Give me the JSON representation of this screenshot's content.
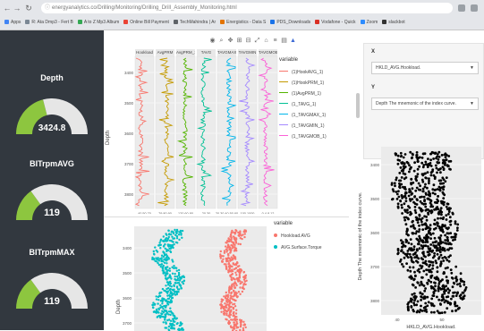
{
  "browser": {
    "url": "energyanalytics.co/Drilling/Monitoring/Drilling_Drill_Assembly_Monitoring.html",
    "bookmarks": [
      "Apps",
      "R: Ata Dmp3 - Fert B",
      "A to Z Mp3 Album",
      "Online Bill Payment",
      "TechMahindra | Ar",
      "Energistics - Data S",
      "PDS_Downloads",
      "Vodafone - Quick",
      "Zoom",
      "slackbot"
    ]
  },
  "gauges": [
    {
      "label": "Depth",
      "value": "3424.8",
      "fill": 0.42
    },
    {
      "label": "BITrpmAVG",
      "value": "119",
      "fill": 0.3
    },
    {
      "label": "BITrpmMAX",
      "value": "119",
      "fill": 0.3
    }
  ],
  "track_plot": {
    "legend_title": "variable",
    "y_label": "Depth",
    "y_ticks": [
      "3400",
      "3500",
      "3600",
      "3700",
      "3800"
    ],
    "tracks": [
      {
        "header": "Hookload",
        "x_ticks": "40 50 70",
        "color": "#f8766d"
      },
      {
        "header": "AvgPRM",
        "x_ticks": "79 80 90",
        "color": "#c49a00"
      },
      {
        "header": "AvgPRM_1",
        "x_ticks": "120 60 80",
        "color": "#53b400"
      },
      {
        "header": "TAVG",
        "x_ticks": "20 30",
        "color": "#00c094"
      },
      {
        "header": "TAVGMAX",
        "x_ticks": "20 30 40 50 60",
        "color": "#00b6eb"
      },
      {
        "header": "TAVGMIN",
        "x_ticks": "100 1000",
        "color": "#a58aff"
      },
      {
        "header": "TAVGMOB",
        "x_ticks": "0 4 8 12",
        "color": "#fb61d7"
      }
    ],
    "legend": [
      {
        "label": "(1)HookAVG_1)",
        "color": "#f8766d"
      },
      {
        "label": "(1)HookPRM_1)",
        "color": "#c49a00"
      },
      {
        "label": "(1)AvgPRM_1)",
        "color": "#53b400"
      },
      {
        "label": "(1_TAVG_1)",
        "color": "#00c094"
      },
      {
        "label": "(1_TAVGMAX_1)",
        "color": "#00b6eb"
      },
      {
        "label": "(1_TAVGMIN_1)",
        "color": "#a58aff"
      },
      {
        "label": "(1_TAVGMOB_1)",
        "color": "#fb61d7"
      }
    ]
  },
  "scatter_left": {
    "legend_title": "variable",
    "y_label": "Depth",
    "y_ticks": [
      "3400",
      "3500",
      "3600",
      "3700"
    ],
    "legend": [
      {
        "label": "Hookload.AVG",
        "color": "#f8766d"
      },
      {
        "label": "AVG.Surface.Torque",
        "color": "#00bfc4"
      }
    ]
  },
  "controls": {
    "x_label": "X",
    "x_value": "HKLD_AVG.Hookload.",
    "y_label": "Y",
    "y_value": "Depth The mnemonic of the index curve."
  },
  "scatter_right": {
    "x_label": "HKLD_AVG.Hookload.",
    "y_label": "Depth The mnemonic of the index curve.",
    "x_ticks": [
      "40",
      "50"
    ],
    "y_ticks": [
      "3400",
      "3500",
      "3600",
      "3700",
      "3800"
    ]
  },
  "chart_data": [
    {
      "type": "line",
      "title": "",
      "ylabel": "Depth",
      "ylim": [
        3330,
        3850
      ],
      "series": [
        {
          "name": "(1)HookAVG_1)"
        },
        {
          "name": "(1)HookPRM_1)"
        },
        {
          "name": "(1)AvgPRM_1)"
        },
        {
          "name": "(1_TAVG_1)"
        },
        {
          "name": "(1_TAVGMAX_1)"
        },
        {
          "name": "(1_TAVGMIN_1)"
        },
        {
          "name": "(1_TAVGMOB_1)"
        }
      ]
    },
    {
      "type": "scatter",
      "ylabel": "Depth",
      "ylim": [
        3330,
        3780
      ],
      "series": [
        {
          "name": "Hookload.AVG"
        },
        {
          "name": "AVG.Surface.Torque"
        }
      ]
    },
    {
      "type": "scatter",
      "xlabel": "HKLD_AVG.Hookload.",
      "ylabel": "Depth The mnemonic of the index curve.",
      "xlim": [
        35,
        60
      ],
      "ylim": [
        3330,
        3850
      ]
    }
  ]
}
